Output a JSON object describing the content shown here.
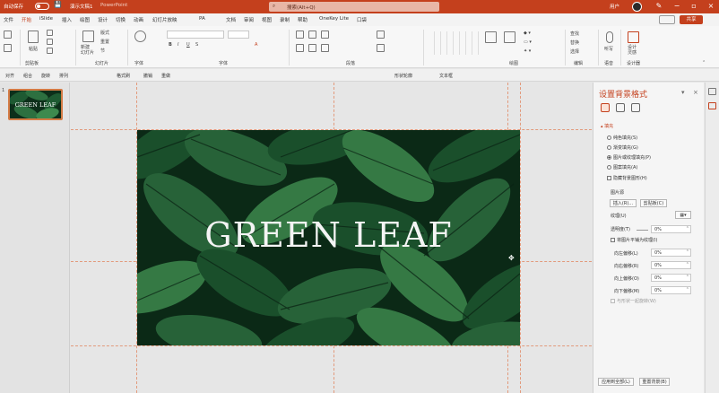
{
  "titlebar": {
    "autosave_label": "自动保存",
    "file_name": "演示文稿1",
    "app_name": "PowerPoint",
    "search_placeholder": "搜索(Alt+Q)",
    "user_name": "用户"
  },
  "menu": {
    "tabs": [
      "文件",
      "开始",
      "iSlide",
      "插入",
      "绘图",
      "设计",
      "切换",
      "动画",
      "幻灯片放映",
      "PA",
      "文档",
      "审阅",
      "视图",
      "录制",
      "帮助",
      "OneKey Lite",
      "口袋"
    ],
    "share_label": "共享"
  },
  "ribbon": {
    "groups": [
      "剪贴板",
      "幻灯片",
      "字体",
      "段落",
      "绘图",
      "编辑",
      "语音",
      "设计器"
    ],
    "paste_label": "粘贴",
    "new_slide_label": "新建\n幻灯片",
    "layout_label": "版式",
    "reset_label": "重置",
    "section_label": "节",
    "find_label": "查找",
    "replace_label": "替换",
    "select_label": "选择",
    "dictate_label": "听写",
    "designer_label": "设计\n灵感"
  },
  "quickbar": {
    "items": [
      "对齐",
      "组合",
      "旋转",
      "排列",
      "格式刷",
      "撤销",
      "重做",
      "形状轮廓",
      "文本框"
    ]
  },
  "thumbnail": {
    "number": "1",
    "title": "GREEN LEAF"
  },
  "slide": {
    "title": "GREEN LEAF"
  },
  "format_pane": {
    "title": "设置背景格式",
    "section_fill": "填充",
    "fill_options": [
      "纯色填充(S)",
      "渐变填充(G)",
      "图片或纹理填充(P)",
      "图案填充(A)"
    ],
    "selected_fill": 2,
    "hide_bg_label": "隐藏背景图形(H)",
    "picture_source": "图片源",
    "insert_btn": "插入(R)...",
    "clipboard_btn": "剪贴板(C)",
    "texture_label": "纹理(U)",
    "transparency_label": "透明度(T)",
    "transparency_value": "0%",
    "tile_label": "将图片平铺为纹理(I)",
    "offsets": [
      {
        "label": "向左偏移(L)",
        "value": "0%"
      },
      {
        "label": "向右偏移(R)",
        "value": "0%"
      },
      {
        "label": "向上偏移(O)",
        "value": "0%"
      },
      {
        "label": "向下偏移(M)",
        "value": "0%"
      }
    ],
    "rotate_label": "与形状一起旋转(W)",
    "apply_all_btn": "应用到全部(L)",
    "reset_bg_btn": "重置背景(B)"
  },
  "colors": {
    "accent": "#c4401d",
    "leaf_dark": "#0d2f1a",
    "leaf_mid": "#1e5a32",
    "leaf_light": "#3d8a4e"
  }
}
